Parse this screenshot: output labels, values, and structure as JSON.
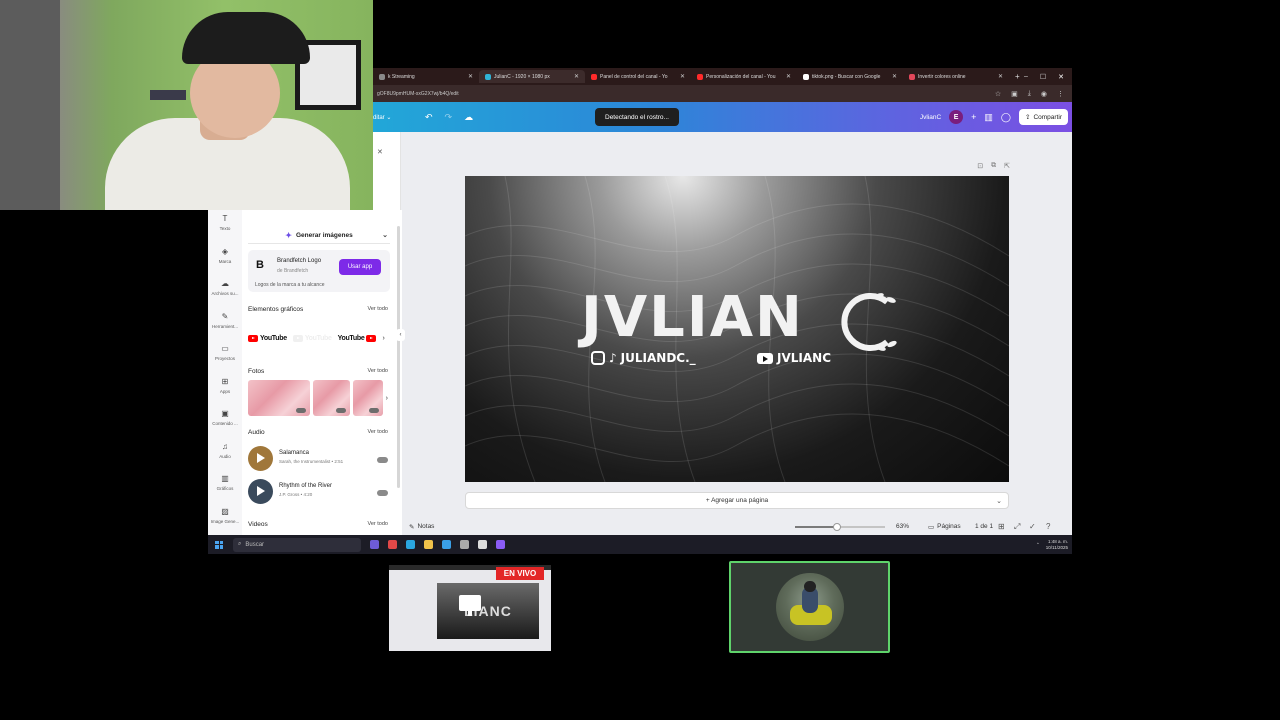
{
  "browser": {
    "tabs": [
      {
        "label": "k Streaming",
        "color": "#8a8a8a",
        "active": false
      },
      {
        "label": "JulianC - 1920 × 1080 px",
        "color": "#2fb3d6",
        "active": true
      },
      {
        "label": "Panel de control del canal - Yo",
        "color": "#ff2a2a",
        "active": false
      },
      {
        "label": "Personalización del canal - You",
        "color": "#ff2a2a",
        "active": false
      },
      {
        "label": "tiktok.png - Buscar con Google",
        "color": "#ffffff",
        "active": false
      },
      {
        "label": "Invertir colores online",
        "color": "#e2475a",
        "active": false
      }
    ],
    "new_tab": "+",
    "minimize": "–",
    "maximize": "☐",
    "close": "✕",
    "url": "gOF8U9pmHUM-sxG2X7wj/b4Q/edit"
  },
  "canva": {
    "edit_label": "ditar ⌄",
    "toast": "Detectando el rostro...",
    "user_name": "JvlianC",
    "avatar_letter": "E",
    "plus": "+",
    "share_label": "Compartir",
    "design": {
      "logo_text": "JVLIAN",
      "instagram_tiktok_handle": "JULIANDC._",
      "youtube_handle": "JVLIANC"
    },
    "add_page_label": "+ Agregar una página",
    "footer": {
      "notes_label": "Notas",
      "zoom_percent": 63,
      "zoom_label": "63%",
      "pages_label": "Páginas",
      "page_count": "1 de 1"
    }
  },
  "panel": {
    "nav": [
      {
        "label": "Texto",
        "icon": "text-icon"
      },
      {
        "label": "Marca",
        "icon": "brand-icon"
      },
      {
        "label": "Archivos su...",
        "icon": "upload-icon"
      },
      {
        "label": "Herramient...",
        "icon": "tools-icon"
      },
      {
        "label": "Proyectos",
        "icon": "folder-icon"
      },
      {
        "label": "Apps",
        "icon": "apps-icon"
      },
      {
        "label": "Contenido ...",
        "icon": "content-icon"
      },
      {
        "label": "Audio",
        "icon": "music-icon"
      },
      {
        "label": "Gráficos",
        "icon": "chart-icon"
      },
      {
        "label": "Image Gene...",
        "icon": "image-gen-icon"
      }
    ],
    "generate_label": "Generar imágenes",
    "brandfetch": {
      "title": "Brandfetch Logo",
      "subtitle": "de Brandfetch",
      "description": "Logos de la marca a tu alcance",
      "button": "Usar app"
    },
    "graphics": {
      "title": "Elementos gráficos",
      "see_all": "Ver todo",
      "logo_word": "YouTube"
    },
    "photos": {
      "title": "Fotos",
      "see_all": "Ver todo"
    },
    "audio": {
      "title": "Audio",
      "see_all": "Ver todo",
      "tracks": [
        {
          "title": "Salamanca",
          "meta": "Sarah, the Instrumentalist • 2:51",
          "color": "#a0773a"
        },
        {
          "title": "Rhythm of the River",
          "meta": "J.P. Gross • 4:20",
          "color": "#3a4a5c"
        }
      ]
    },
    "videos": {
      "title": "Videos",
      "see_all": "Ver todo"
    }
  },
  "taskbar": {
    "search_placeholder": "Buscar",
    "apps": [
      "#6e5cd8",
      "#e24848",
      "#2aa6df",
      "#f0c24a",
      "#3aa0e8",
      "#aaaaaa",
      "#dddddd",
      "#8b5cf6"
    ],
    "time": "1:48 a. m.",
    "date": "10/11/2025"
  },
  "thumbnails": {
    "live_badge": "EN VIVO",
    "preview_text": "LIANC"
  }
}
